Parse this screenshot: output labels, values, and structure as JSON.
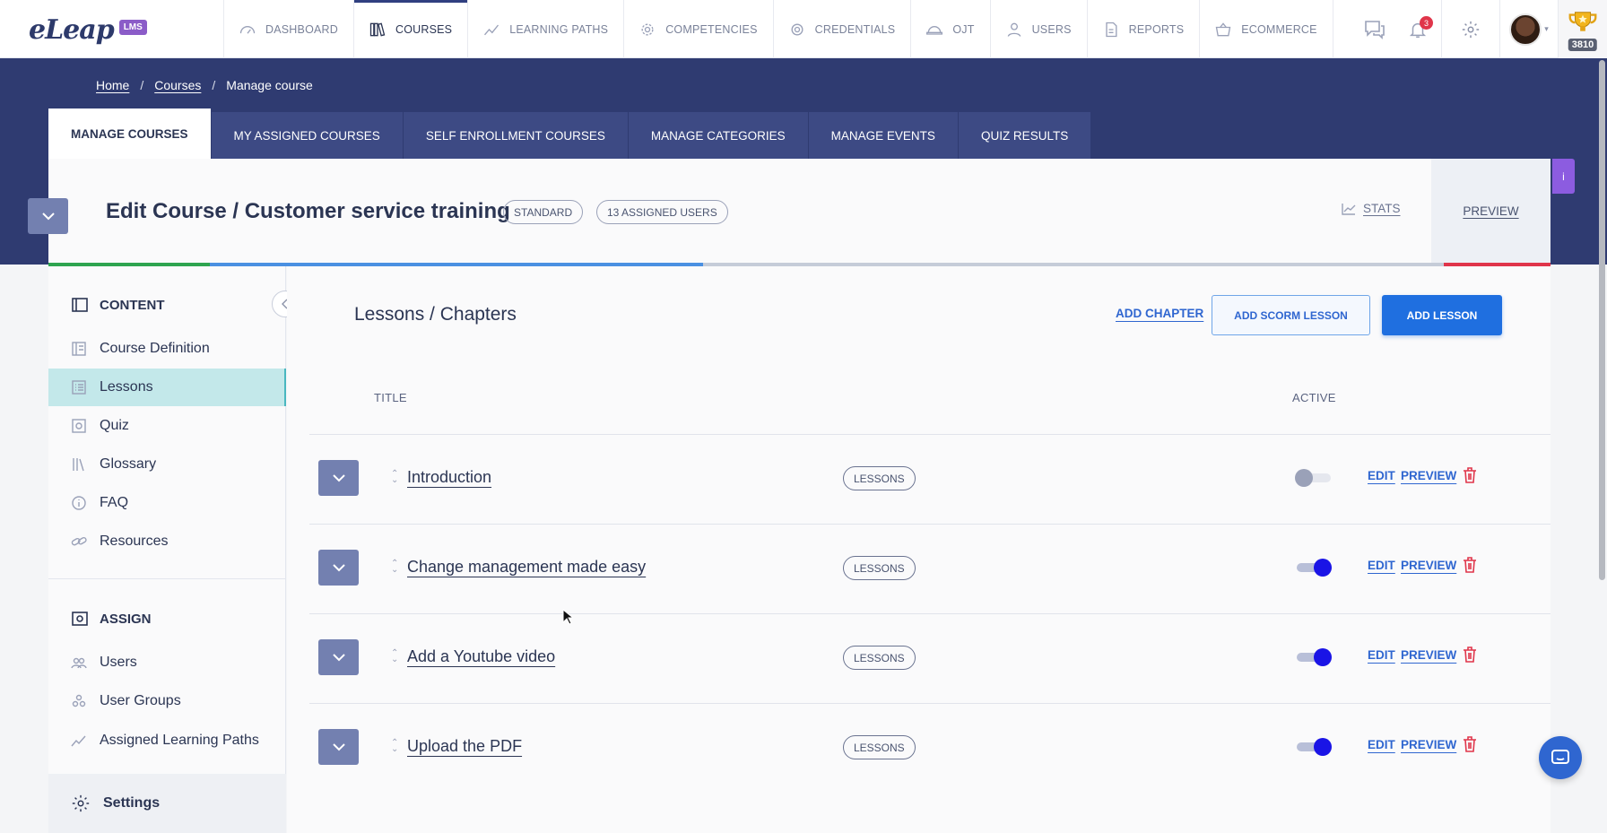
{
  "brand": {
    "logo_text": "eLeap",
    "logo_badge": "LMS"
  },
  "topnav": {
    "items": [
      {
        "label": "DASHBOARD",
        "icon": "speedometer-icon",
        "active": false
      },
      {
        "label": "COURSES",
        "icon": "books-icon",
        "active": true
      },
      {
        "label": "LEARNING PATHS",
        "icon": "trend-line-icon",
        "active": false
      },
      {
        "label": "COMPETENCIES",
        "icon": "gear-cog-icon",
        "active": false
      },
      {
        "label": "CREDENTIALS",
        "icon": "certificate-icon",
        "active": false
      },
      {
        "label": "OJT",
        "icon": "hard-hat-icon",
        "active": false
      },
      {
        "label": "USERS",
        "icon": "user-icon",
        "active": false
      },
      {
        "label": "REPORTS",
        "icon": "report-document-icon",
        "active": false
      },
      {
        "label": "ECOMMERCE",
        "icon": "basket-icon",
        "active": false
      }
    ],
    "notification_count": "3",
    "points": "3810"
  },
  "breadcrumb": {
    "home": "Home",
    "courses": "Courses",
    "current": "Manage course",
    "separator": "/"
  },
  "tabs": [
    {
      "label": "MANAGE COURSES",
      "active": true
    },
    {
      "label": "MY ASSIGNED COURSES",
      "active": false
    },
    {
      "label": "SELF ENROLLMENT COURSES",
      "active": false
    },
    {
      "label": "MANAGE CATEGORIES",
      "active": false
    },
    {
      "label": "MANAGE EVENTS",
      "active": false
    },
    {
      "label": "QUIZ RESULTS",
      "active": false
    }
  ],
  "course": {
    "title": "Edit Course / Customer service training",
    "type_badge": "STANDARD",
    "assigned_badge": "13 ASSIGNED USERS",
    "stats_label": "STATS",
    "preview_label": "PREVIEW",
    "side_tag": "i"
  },
  "progress_colors": [
    "#2ea44f",
    "#4a90e2",
    "#c5ccd8",
    "#e0354a"
  ],
  "sidebar": {
    "content_title": "CONTENT",
    "content_items": [
      {
        "label": "Course Definition",
        "icon": "document-icon",
        "active": false
      },
      {
        "label": "Lessons",
        "icon": "list-icon",
        "active": true
      },
      {
        "label": "Quiz",
        "icon": "quiz-icon",
        "active": false
      },
      {
        "label": "Glossary",
        "icon": "glossary-icon",
        "active": false
      },
      {
        "label": "FAQ",
        "icon": "info-icon",
        "active": false
      },
      {
        "label": "Resources",
        "icon": "link-icon",
        "active": false
      }
    ],
    "assign_title": "ASSIGN",
    "assign_items": [
      {
        "label": "Users",
        "icon": "users-icon"
      },
      {
        "label": "User Groups",
        "icon": "user-groups-icon"
      },
      {
        "label": "Assigned Learning Paths",
        "icon": "trend-line-icon"
      }
    ],
    "settings_label": "Settings"
  },
  "main": {
    "title": "Lessons / Chapters",
    "add_chapter": "ADD CHAPTER",
    "add_scorm": "ADD SCORM LESSON",
    "add_lesson": "ADD LESSON",
    "col_title": "TITLE",
    "col_active": "ACTIVE",
    "rows": [
      {
        "title": "Introduction",
        "tag": "LESSONS",
        "active": false,
        "edit": "EDIT",
        "preview": "PREVIEW"
      },
      {
        "title": "Change management made easy",
        "tag": "LESSONS",
        "active": true,
        "edit": "EDIT",
        "preview": "PREVIEW"
      },
      {
        "title": "Add a Youtube video",
        "tag": "LESSONS",
        "active": true,
        "edit": "EDIT",
        "preview": "PREVIEW"
      },
      {
        "title": "Upload the PDF",
        "tag": "LESSONS",
        "active": true,
        "edit": "EDIT",
        "preview": "PREVIEW"
      }
    ]
  }
}
